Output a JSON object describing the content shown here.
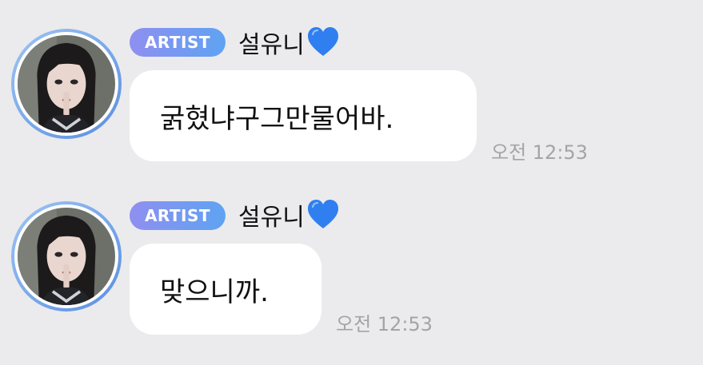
{
  "messages": [
    {
      "badge": "ARTIST",
      "sender": "설유니",
      "sender_emoji_icon": "blue-heart-icon",
      "text": "굵혔냐구그만물어바.",
      "time": "오전 12:53"
    },
    {
      "badge": "ARTIST",
      "sender": "설유니",
      "sender_emoji_icon": "blue-heart-icon",
      "text": "맞으니까.",
      "time": "오전 12:53"
    }
  ],
  "colors": {
    "background": "#ebebed",
    "bubble": "#ffffff",
    "badge_gradient_start": "#8f8ff0",
    "badge_gradient_end": "#5fa3f2",
    "heart": "#2f7ff0",
    "time_text": "#a4a4a8"
  }
}
